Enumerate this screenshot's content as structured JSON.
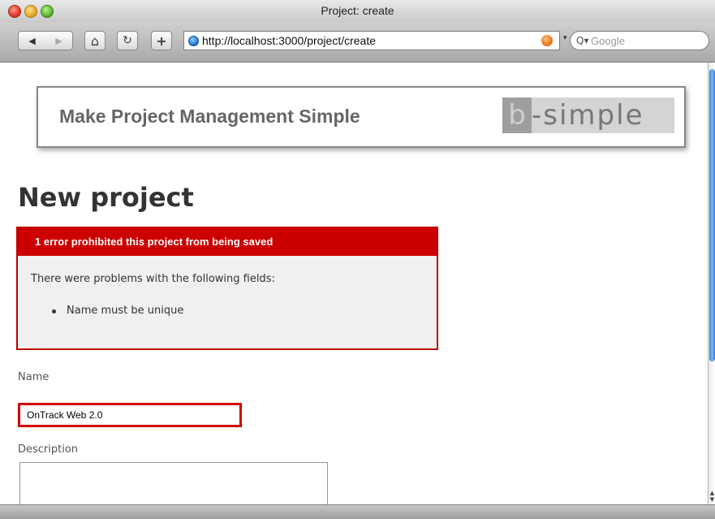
{
  "window": {
    "title": "Project: create"
  },
  "toolbar": {
    "back_glyph": "◀",
    "forward_glyph": "▶",
    "home_glyph": "⌂",
    "reload_glyph": "↻",
    "add_glyph": "+",
    "url": "http://localhost:3000/project/create",
    "search_placeholder": "Google",
    "search_glyph": "Q▾",
    "dropdown_glyph": "▾"
  },
  "header": {
    "tagline": "Make Project Management Simple",
    "logo_first": "b",
    "logo_rest": "-simple"
  },
  "page": {
    "title": "New project"
  },
  "error": {
    "header": "1 error prohibited this project from being saved",
    "intro": "There were problems with the following fields:",
    "items": [
      "Name must be unique"
    ]
  },
  "form": {
    "name_label": "Name",
    "name_value": "OnTrack Web 2.0",
    "description_label": "Description",
    "description_value": ""
  },
  "colors": {
    "error_red": "#cc0000",
    "scroll_blue": "#2f79d8"
  },
  "icons": [
    "back-icon",
    "forward-icon",
    "home-icon",
    "reload-icon",
    "add-icon",
    "globe-icon",
    "rss-icon",
    "search-icon"
  ]
}
